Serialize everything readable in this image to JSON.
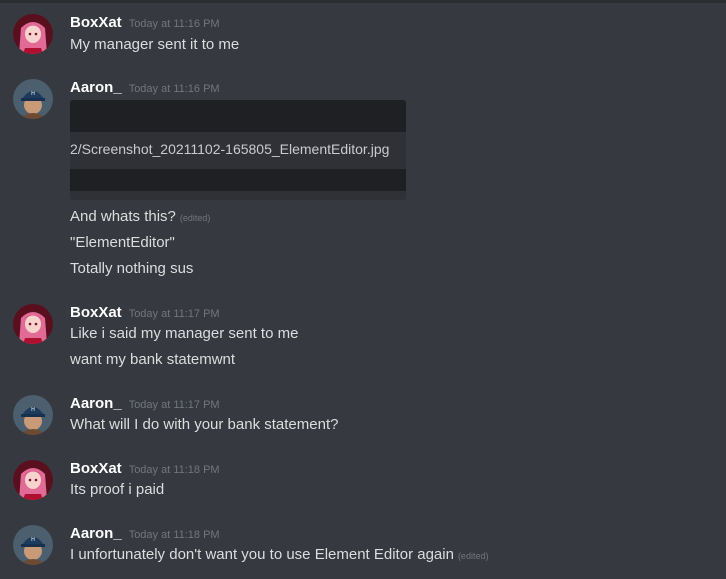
{
  "messages": [
    {
      "username": "BoxXat",
      "timestamp": "Today at 11:16 PM",
      "avatar_icon": "anime-girl-avatar-icon",
      "lines": [
        {
          "text": "My manager sent it to me"
        }
      ]
    },
    {
      "username": "Aaron_",
      "timestamp": "Today at 11:16 PM",
      "avatar_icon": "baseball-cap-avatar-icon",
      "attachment": {
        "filename": "2/Screenshot_20211102-165805_ElementEditor.jpg"
      },
      "lines": [
        {
          "text": "And whats this?",
          "edited": "(edited)"
        },
        {
          "text": "\"ElementEditor\""
        },
        {
          "text": "Totally nothing sus"
        }
      ]
    },
    {
      "username": "BoxXat",
      "timestamp": "Today at 11:17 PM",
      "avatar_icon": "anime-girl-avatar-icon",
      "lines": [
        {
          "text": "Like i said my manager sent to me"
        },
        {
          "text": "want my bank statemwnt"
        }
      ]
    },
    {
      "username": "Aaron_",
      "timestamp": "Today at 11:17 PM",
      "avatar_icon": "baseball-cap-avatar-icon",
      "lines": [
        {
          "text": "What will I do with your bank statement?"
        }
      ]
    },
    {
      "username": "BoxXat",
      "timestamp": "Today at 11:18 PM",
      "avatar_icon": "anime-girl-avatar-icon",
      "lines": [
        {
          "text": "Its proof i paid"
        }
      ]
    },
    {
      "username": "Aaron_",
      "timestamp": "Today at 11:18 PM",
      "avatar_icon": "baseball-cap-avatar-icon",
      "lines": [
        {
          "text": "I unfortunately don't want you to use Element Editor again",
          "edited": "(edited)"
        }
      ]
    }
  ],
  "colors": {
    "background": "#36393f",
    "username": "#ffffff",
    "message_text": "#dcddde",
    "muted": "#72767d",
    "embed_background": "#2f3136"
  }
}
